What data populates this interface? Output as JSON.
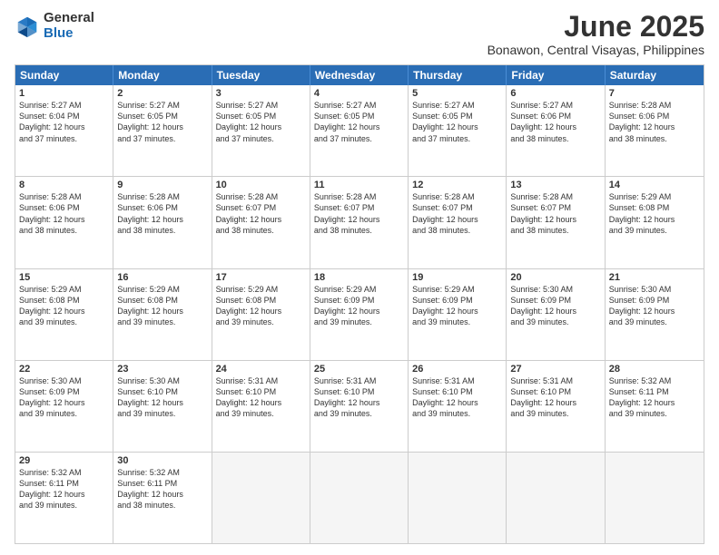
{
  "header": {
    "logo_general": "General",
    "logo_blue": "Blue",
    "month_title": "June 2025",
    "location": "Bonawon, Central Visayas, Philippines"
  },
  "weekdays": [
    "Sunday",
    "Monday",
    "Tuesday",
    "Wednesday",
    "Thursday",
    "Friday",
    "Saturday"
  ],
  "rows": [
    [
      {
        "day": "1",
        "lines": [
          "Sunrise: 5:27 AM",
          "Sunset: 6:04 PM",
          "Daylight: 12 hours",
          "and 37 minutes."
        ]
      },
      {
        "day": "2",
        "lines": [
          "Sunrise: 5:27 AM",
          "Sunset: 6:05 PM",
          "Daylight: 12 hours",
          "and 37 minutes."
        ]
      },
      {
        "day": "3",
        "lines": [
          "Sunrise: 5:27 AM",
          "Sunset: 6:05 PM",
          "Daylight: 12 hours",
          "and 37 minutes."
        ]
      },
      {
        "day": "4",
        "lines": [
          "Sunrise: 5:27 AM",
          "Sunset: 6:05 PM",
          "Daylight: 12 hours",
          "and 37 minutes."
        ]
      },
      {
        "day": "5",
        "lines": [
          "Sunrise: 5:27 AM",
          "Sunset: 6:05 PM",
          "Daylight: 12 hours",
          "and 37 minutes."
        ]
      },
      {
        "day": "6",
        "lines": [
          "Sunrise: 5:27 AM",
          "Sunset: 6:06 PM",
          "Daylight: 12 hours",
          "and 38 minutes."
        ]
      },
      {
        "day": "7",
        "lines": [
          "Sunrise: 5:28 AM",
          "Sunset: 6:06 PM",
          "Daylight: 12 hours",
          "and 38 minutes."
        ]
      }
    ],
    [
      {
        "day": "8",
        "lines": [
          "Sunrise: 5:28 AM",
          "Sunset: 6:06 PM",
          "Daylight: 12 hours",
          "and 38 minutes."
        ]
      },
      {
        "day": "9",
        "lines": [
          "Sunrise: 5:28 AM",
          "Sunset: 6:06 PM",
          "Daylight: 12 hours",
          "and 38 minutes."
        ]
      },
      {
        "day": "10",
        "lines": [
          "Sunrise: 5:28 AM",
          "Sunset: 6:07 PM",
          "Daylight: 12 hours",
          "and 38 minutes."
        ]
      },
      {
        "day": "11",
        "lines": [
          "Sunrise: 5:28 AM",
          "Sunset: 6:07 PM",
          "Daylight: 12 hours",
          "and 38 minutes."
        ]
      },
      {
        "day": "12",
        "lines": [
          "Sunrise: 5:28 AM",
          "Sunset: 6:07 PM",
          "Daylight: 12 hours",
          "and 38 minutes."
        ]
      },
      {
        "day": "13",
        "lines": [
          "Sunrise: 5:28 AM",
          "Sunset: 6:07 PM",
          "Daylight: 12 hours",
          "and 38 minutes."
        ]
      },
      {
        "day": "14",
        "lines": [
          "Sunrise: 5:29 AM",
          "Sunset: 6:08 PM",
          "Daylight: 12 hours",
          "and 39 minutes."
        ]
      }
    ],
    [
      {
        "day": "15",
        "lines": [
          "Sunrise: 5:29 AM",
          "Sunset: 6:08 PM",
          "Daylight: 12 hours",
          "and 39 minutes."
        ]
      },
      {
        "day": "16",
        "lines": [
          "Sunrise: 5:29 AM",
          "Sunset: 6:08 PM",
          "Daylight: 12 hours",
          "and 39 minutes."
        ]
      },
      {
        "day": "17",
        "lines": [
          "Sunrise: 5:29 AM",
          "Sunset: 6:08 PM",
          "Daylight: 12 hours",
          "and 39 minutes."
        ]
      },
      {
        "day": "18",
        "lines": [
          "Sunrise: 5:29 AM",
          "Sunset: 6:09 PM",
          "Daylight: 12 hours",
          "and 39 minutes."
        ]
      },
      {
        "day": "19",
        "lines": [
          "Sunrise: 5:29 AM",
          "Sunset: 6:09 PM",
          "Daylight: 12 hours",
          "and 39 minutes."
        ]
      },
      {
        "day": "20",
        "lines": [
          "Sunrise: 5:30 AM",
          "Sunset: 6:09 PM",
          "Daylight: 12 hours",
          "and 39 minutes."
        ]
      },
      {
        "day": "21",
        "lines": [
          "Sunrise: 5:30 AM",
          "Sunset: 6:09 PM",
          "Daylight: 12 hours",
          "and 39 minutes."
        ]
      }
    ],
    [
      {
        "day": "22",
        "lines": [
          "Sunrise: 5:30 AM",
          "Sunset: 6:09 PM",
          "Daylight: 12 hours",
          "and 39 minutes."
        ]
      },
      {
        "day": "23",
        "lines": [
          "Sunrise: 5:30 AM",
          "Sunset: 6:10 PM",
          "Daylight: 12 hours",
          "and 39 minutes."
        ]
      },
      {
        "day": "24",
        "lines": [
          "Sunrise: 5:31 AM",
          "Sunset: 6:10 PM",
          "Daylight: 12 hours",
          "and 39 minutes."
        ]
      },
      {
        "day": "25",
        "lines": [
          "Sunrise: 5:31 AM",
          "Sunset: 6:10 PM",
          "Daylight: 12 hours",
          "and 39 minutes."
        ]
      },
      {
        "day": "26",
        "lines": [
          "Sunrise: 5:31 AM",
          "Sunset: 6:10 PM",
          "Daylight: 12 hours",
          "and 39 minutes."
        ]
      },
      {
        "day": "27",
        "lines": [
          "Sunrise: 5:31 AM",
          "Sunset: 6:10 PM",
          "Daylight: 12 hours",
          "and 39 minutes."
        ]
      },
      {
        "day": "28",
        "lines": [
          "Sunrise: 5:32 AM",
          "Sunset: 6:11 PM",
          "Daylight: 12 hours",
          "and 39 minutes."
        ]
      }
    ],
    [
      {
        "day": "29",
        "lines": [
          "Sunrise: 5:32 AM",
          "Sunset: 6:11 PM",
          "Daylight: 12 hours",
          "and 39 minutes."
        ]
      },
      {
        "day": "30",
        "lines": [
          "Sunrise: 5:32 AM",
          "Sunset: 6:11 PM",
          "Daylight: 12 hours",
          "and 38 minutes."
        ]
      },
      {
        "day": "",
        "lines": []
      },
      {
        "day": "",
        "lines": []
      },
      {
        "day": "",
        "lines": []
      },
      {
        "day": "",
        "lines": []
      },
      {
        "day": "",
        "lines": []
      }
    ]
  ]
}
